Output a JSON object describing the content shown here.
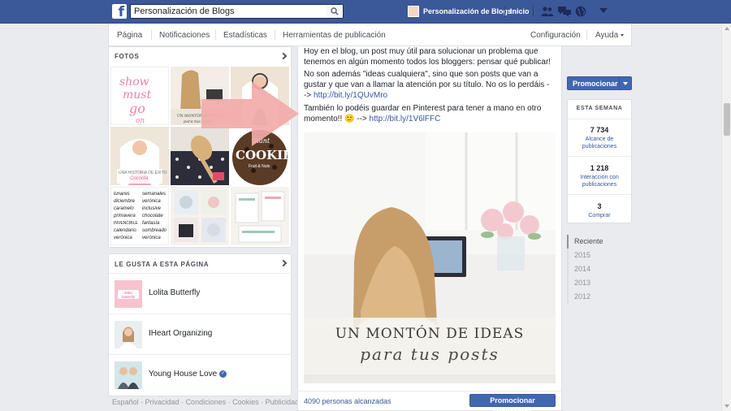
{
  "colors": {
    "brand": "#3b5998",
    "accent": "#4267b2",
    "link": "#365899"
  },
  "topbar": {
    "logo_icon": "facebook-logo-icon",
    "logo_glyph": "f",
    "search_value": "Personalización de Blogs",
    "search_icon": "search-icon",
    "page_name": "Personalización de Blogs",
    "home_label": "Inicio",
    "jewels": [
      "friends-icon",
      "messages-icon",
      "notifications-globe-icon"
    ]
  },
  "subnav": {
    "tabs": [
      "Página",
      "Notificaciones",
      "Estadísticas",
      "Herramientas de publicación"
    ],
    "settings_label": "Configuración",
    "help_label": "Ayuda"
  },
  "photos": {
    "title": "FOTOS",
    "tile_text": {
      "show_must": "show must go on",
      "book": "UN MONTÓN DE IDEAS para tus posts",
      "story": "UNA HISTORIA DE ÉXITO",
      "story_name": "Cocorita",
      "cookie_top": "Giant",
      "cookie_main": "COOKIE",
      "cookie_bottom": "Fruit & Nuts"
    },
    "words_col1": [
      "lunares",
      "diciembre",
      "caramelo",
      "primavera",
      "INVENCIBLE",
      "calendario",
      "verónica"
    ],
    "words_col2": [
      "semanales",
      "verónica",
      "inclusive",
      "chocolate",
      "fantasía",
      "sombreado",
      "verónica"
    ]
  },
  "likes": {
    "title": "LE GUSTA A ESTA PÁGINA",
    "pages": [
      {
        "name": "Lolita Butterfly",
        "verified": false,
        "thumb_text": "lolita butterfly"
      },
      {
        "name": "IHeart Organizing",
        "verified": false
      },
      {
        "name": "Young House Love",
        "verified": true
      }
    ]
  },
  "footer": {
    "links": [
      "Español",
      "Privacidad",
      "Condiciones",
      "Cookies",
      "Publicidad"
    ]
  },
  "post": {
    "para1": "Hoy en el blog, un post muy útil para solucionar un problema que tenemos en algún momento todos los bloggers: pensar qué publicar!",
    "para2": "No son además \"ideas cualquiera\", sino que son posts que van a gustar y que van a llamar la atención por su título. No os lo perdáis -->",
    "link1": "http://bit.ly/1QUvMro",
    "para3": "También lo podéis guardar en Pinterest para tener a mano en otro momento!! 🙂 --> ",
    "link2": "http://bit.ly/1V6lFFC",
    "image_title": "UN MONTÓN DE IDEAS",
    "image_subtitle": "para tus posts",
    "reach": "4090 personas alcanzadas",
    "boost_label": "Promocionar publicación"
  },
  "sidebar_right": {
    "promote_label": "Promocionar",
    "week_title": "ESTA SEMANA",
    "stats": [
      {
        "value": "7 734",
        "label": "Alcance de publicaciones"
      },
      {
        "value": "1 218",
        "label": "Interacción con publicaciones"
      },
      {
        "value": "3",
        "label": "Comprar"
      }
    ],
    "years": [
      "Reciente",
      "2015",
      "2014",
      "2013",
      "2012"
    ]
  }
}
